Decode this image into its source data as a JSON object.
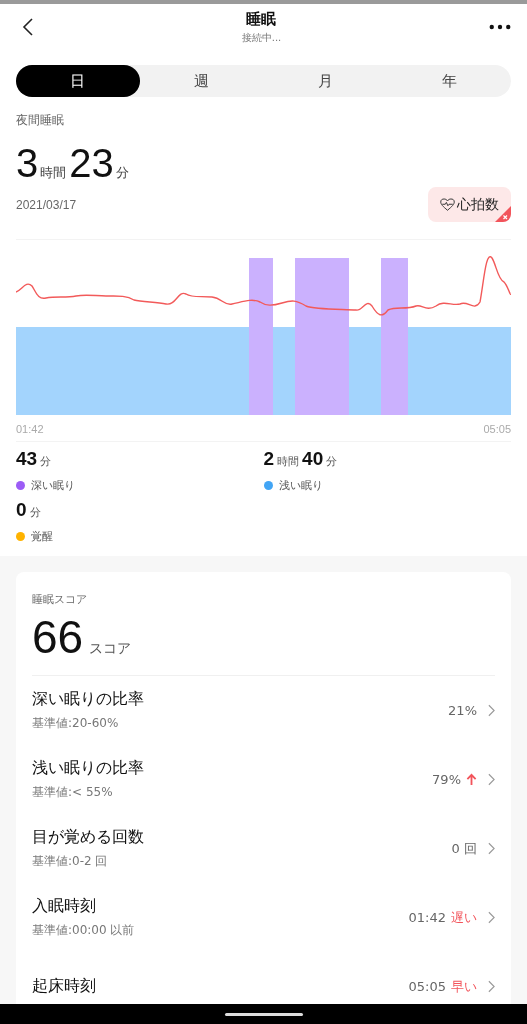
{
  "header": {
    "title": "睡眠",
    "subtitle": "接続中..."
  },
  "tabs": [
    {
      "label": "日",
      "selected": true
    },
    {
      "label": "週",
      "selected": false
    },
    {
      "label": "月",
      "selected": false
    },
    {
      "label": "年",
      "selected": false
    }
  ],
  "summary": {
    "label": "夜間睡眠",
    "duration": [
      {
        "kind": "number",
        "text": "3"
      },
      {
        "kind": "unit",
        "text": "時間"
      },
      {
        "kind": "number",
        "text": "23"
      },
      {
        "kind": "unit",
        "text": "分"
      }
    ],
    "date": "2021/03/17",
    "heart_rate_chip": {
      "label": "心拍数",
      "selected": true
    }
  },
  "chart": {
    "start": "01:42",
    "end": "05:05"
  },
  "stages": [
    {
      "label": "深い眠り",
      "color": "#9c5cf6",
      "duration": [
        {
          "kind": "number",
          "text": "43"
        },
        {
          "kind": "unit",
          "text": "分"
        }
      ]
    },
    {
      "label": "浅い眠り",
      "color": "#42a5f5",
      "duration": [
        {
          "kind": "number",
          "text": "2"
        },
        {
          "kind": "unit",
          "text": "時間"
        },
        {
          "kind": "number",
          "text": "40"
        },
        {
          "kind": "unit",
          "text": "分"
        }
      ]
    },
    {
      "label": "覚醒",
      "color": "#ffb300",
      "duration": [
        {
          "kind": "number",
          "text": "0"
        },
        {
          "kind": "unit",
          "text": "分"
        }
      ]
    }
  ],
  "score": {
    "label": "睡眠スコア",
    "value": "66",
    "unit": "スコア"
  },
  "metrics": [
    {
      "title": "深い眠りの比率",
      "reference": "基準値:20-60%",
      "value": "21%",
      "rising": false
    },
    {
      "title": "浅い眠りの比率",
      "reference": "基準値:< 55%",
      "value": "79%",
      "rising": true
    },
    {
      "title": "目が覚める回数",
      "reference": "基準値:0-2 回",
      "value": "0 回",
      "rising": false
    },
    {
      "title": "入眠時刻",
      "reference": "基準値:00:00 以前",
      "value": "01:42",
      "status": "遅い",
      "rising": false
    },
    {
      "title": "起床時刻",
      "value": "05:05",
      "status": "早い",
      "rising": false
    }
  ]
}
